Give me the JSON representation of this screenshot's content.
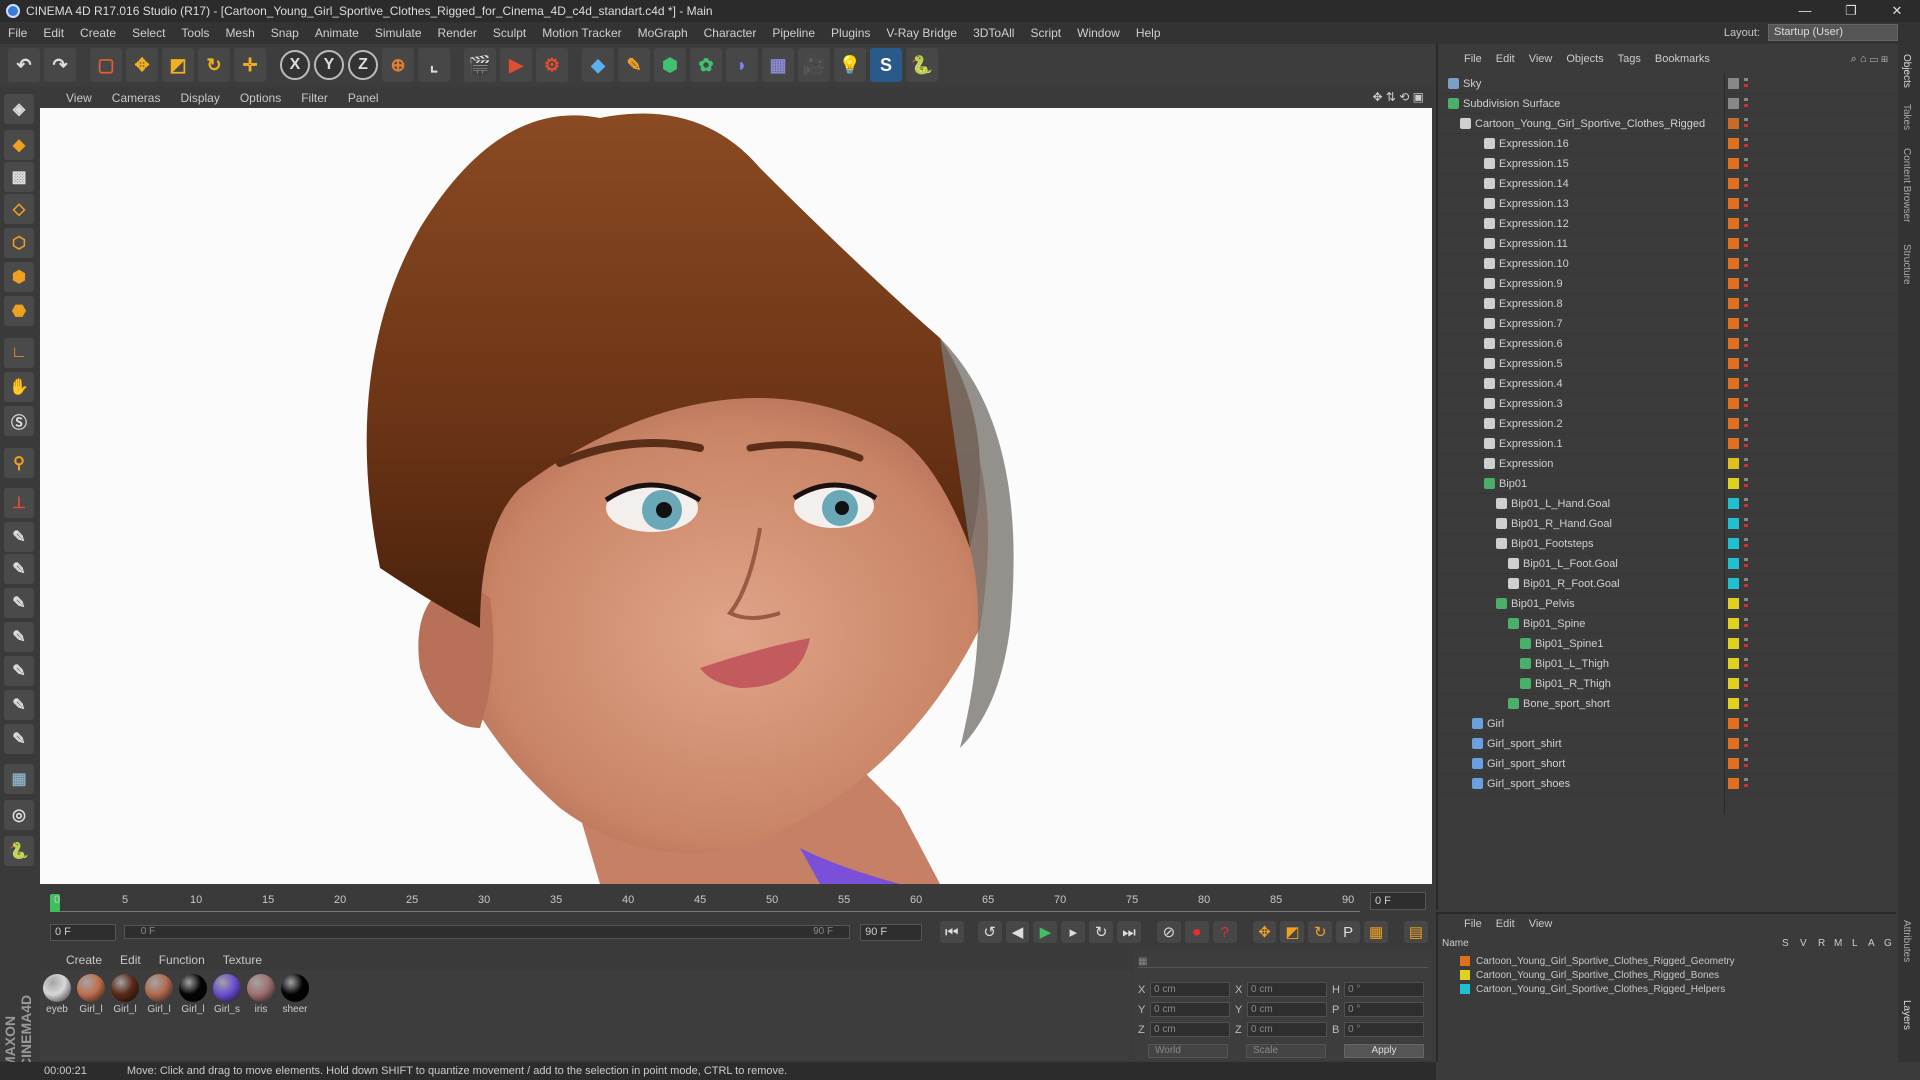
{
  "window": {
    "title": "CINEMA 4D R17.016 Studio (R17) - [Cartoon_Young_Girl_Sportive_Clothes_Rigged_for_Cinema_4D_c4d_standart.c4d *] - Main",
    "min": "—",
    "max": "❐",
    "close": "✕"
  },
  "menubar": {
    "items": [
      "File",
      "Edit",
      "Create",
      "Select",
      "Tools",
      "Mesh",
      "Snap",
      "Animate",
      "Simulate",
      "Render",
      "Sculpt",
      "Motion Tracker",
      "MoGraph",
      "Character",
      "Pipeline",
      "Plugins",
      "V-Ray Bridge",
      "3DToAll",
      "Script",
      "Window",
      "Help"
    ],
    "layout_label": "Layout:",
    "layout_value": "Startup (User)"
  },
  "viewport_menu": [
    "View",
    "Cameras",
    "Display",
    "Options",
    "Filter",
    "Panel"
  ],
  "timeline": {
    "ticks": [
      "0",
      "5",
      "10",
      "15",
      "20",
      "25",
      "30",
      "35",
      "40",
      "45",
      "50",
      "55",
      "60",
      "65",
      "70",
      "75",
      "80",
      "85",
      "90"
    ],
    "current_frame": "0 F"
  },
  "playbar": {
    "start": "0 F",
    "slider_start": "0 F",
    "slider_end": "90 F",
    "end": "90 F"
  },
  "material_menu": [
    "Create",
    "Edit",
    "Function",
    "Texture"
  ],
  "materials": [
    {
      "label": "eyeb",
      "color": "#d8d8d8"
    },
    {
      "label": "Girl_l",
      "color": "#c07050"
    },
    {
      "label": "Girl_l",
      "color": "#5a2a18"
    },
    {
      "label": "Girl_l",
      "color": "#b06a50"
    },
    {
      "label": "Girl_l",
      "color": "#050505"
    },
    {
      "label": "Girl_s",
      "color": "#6b4fd0"
    },
    {
      "label": "iris",
      "color": "#a07070"
    },
    {
      "label": "sheer",
      "color": "#020202"
    }
  ],
  "coords": {
    "rows": [
      [
        {
          "c": "X",
          "v": "0 cm"
        },
        {
          "c": "X",
          "v": "0 cm"
        },
        {
          "c": "H",
          "v": "0 °"
        }
      ],
      [
        {
          "c": "Y",
          "v": "0 cm"
        },
        {
          "c": "Y",
          "v": "0 cm"
        },
        {
          "c": "P",
          "v": "0 °"
        }
      ],
      [
        {
          "c": "Z",
          "v": "0 cm"
        },
        {
          "c": "Z",
          "v": "0 cm"
        },
        {
          "c": "B",
          "v": "0 °"
        }
      ]
    ],
    "world": "World",
    "scale": "Scale",
    "apply": "Apply"
  },
  "status": {
    "time": "00:00:21",
    "message": "Move: Click and drag to move elements. Hold down SHIFT to quantize movement / add to the selection in point mode, CTRL to remove."
  },
  "object_manager": {
    "menu": [
      "File",
      "Edit",
      "View",
      "Objects",
      "Tags",
      "Bookmarks"
    ],
    "objects": [
      {
        "name": "Sky",
        "indent": 0,
        "icon": "#7aa0c8",
        "tag": "#888"
      },
      {
        "name": "Subdivision Surface",
        "indent": 0,
        "icon": "#49b06a",
        "tag": "#888"
      },
      {
        "name": "Cartoon_Young_Girl_Sportive_Clothes_Rigged",
        "indent": 1,
        "icon": "#cfcfcf",
        "tag": "#c86a2a"
      },
      {
        "name": "Expression.16",
        "indent": 3,
        "icon": "#cfcfcf",
        "tag": "#e07020"
      },
      {
        "name": "Expression.15",
        "indent": 3,
        "icon": "#cfcfcf",
        "tag": "#e07020"
      },
      {
        "name": "Expression.14",
        "indent": 3,
        "icon": "#cfcfcf",
        "tag": "#e07020"
      },
      {
        "name": "Expression.13",
        "indent": 3,
        "icon": "#cfcfcf",
        "tag": "#e07020"
      },
      {
        "name": "Expression.12",
        "indent": 3,
        "icon": "#cfcfcf",
        "tag": "#e07020"
      },
      {
        "name": "Expression.11",
        "indent": 3,
        "icon": "#cfcfcf",
        "tag": "#e07020"
      },
      {
        "name": "Expression.10",
        "indent": 3,
        "icon": "#cfcfcf",
        "tag": "#e07020"
      },
      {
        "name": "Expression.9",
        "indent": 3,
        "icon": "#cfcfcf",
        "tag": "#e07020"
      },
      {
        "name": "Expression.8",
        "indent": 3,
        "icon": "#cfcfcf",
        "tag": "#e07020"
      },
      {
        "name": "Expression.7",
        "indent": 3,
        "icon": "#cfcfcf",
        "tag": "#e07020"
      },
      {
        "name": "Expression.6",
        "indent": 3,
        "icon": "#cfcfcf",
        "tag": "#e07020"
      },
      {
        "name": "Expression.5",
        "indent": 3,
        "icon": "#cfcfcf",
        "tag": "#e07020"
      },
      {
        "name": "Expression.4",
        "indent": 3,
        "icon": "#cfcfcf",
        "tag": "#e07020"
      },
      {
        "name": "Expression.3",
        "indent": 3,
        "icon": "#cfcfcf",
        "tag": "#e07020"
      },
      {
        "name": "Expression.2",
        "indent": 3,
        "icon": "#cfcfcf",
        "tag": "#e07020"
      },
      {
        "name": "Expression.1",
        "indent": 3,
        "icon": "#cfcfcf",
        "tag": "#e07020"
      },
      {
        "name": "Expression",
        "indent": 3,
        "icon": "#cfcfcf",
        "tag": "#e0c020"
      },
      {
        "name": "Bip01",
        "indent": 3,
        "icon": "#49b06a",
        "tag": "#e0d020"
      },
      {
        "name": "Bip01_L_Hand.Goal",
        "indent": 4,
        "icon": "#cfcfcf",
        "tag": "#20c0d0"
      },
      {
        "name": "Bip01_R_Hand.Goal",
        "indent": 4,
        "icon": "#cfcfcf",
        "tag": "#20c0d0"
      },
      {
        "name": "Bip01_Footsteps",
        "indent": 4,
        "icon": "#cfcfcf",
        "tag": "#20c0d0"
      },
      {
        "name": "Bip01_L_Foot.Goal",
        "indent": 5,
        "icon": "#cfcfcf",
        "tag": "#20c0d0"
      },
      {
        "name": "Bip01_R_Foot.Goal",
        "indent": 5,
        "icon": "#cfcfcf",
        "tag": "#20c0d0"
      },
      {
        "name": "Bip01_Pelvis",
        "indent": 4,
        "icon": "#49b06a",
        "tag": "#e0d020"
      },
      {
        "name": "Bip01_Spine",
        "indent": 5,
        "icon": "#49b06a",
        "tag": "#e0d020"
      },
      {
        "name": "Bip01_Spine1",
        "indent": 6,
        "icon": "#49b06a",
        "tag": "#e0d020"
      },
      {
        "name": "Bip01_L_Thigh",
        "indent": 6,
        "icon": "#49b06a",
        "tag": "#e0d020"
      },
      {
        "name": "Bip01_R_Thigh",
        "indent": 6,
        "icon": "#49b06a",
        "tag": "#e0d020"
      },
      {
        "name": "Bone_sport_short",
        "indent": 5,
        "icon": "#49b06a",
        "tag": "#e0d020"
      },
      {
        "name": "Girl",
        "indent": 2,
        "icon": "#6aa0e0",
        "tag": "#e07020"
      },
      {
        "name": "Girl_sport_shirt",
        "indent": 2,
        "icon": "#6aa0e0",
        "tag": "#e07020"
      },
      {
        "name": "Girl_sport_short",
        "indent": 2,
        "icon": "#6aa0e0",
        "tag": "#e07020"
      },
      {
        "name": "Girl_sport_shoes",
        "indent": 2,
        "icon": "#6aa0e0",
        "tag": "#e07020"
      }
    ]
  },
  "side_tabs": [
    "Objects",
    "Takes",
    "Content Browser",
    "Structure",
    "Attributes",
    "Layers"
  ],
  "layer_manager": {
    "menu": [
      "File",
      "Edit",
      "View"
    ],
    "columns": [
      "Name",
      "S",
      "V",
      "R",
      "M",
      "L",
      "A",
      "G"
    ],
    "layers": [
      {
        "name": "Cartoon_Young_Girl_Sportive_Clothes_Rigged_Geometry",
        "color": "#e07020"
      },
      {
        "name": "Cartoon_Young_Girl_Sportive_Clothes_Rigged_Bones",
        "color": "#e0d020"
      },
      {
        "name": "Cartoon_Young_Girl_Sportive_Clothes_Rigged_Helpers",
        "color": "#20c0d0"
      }
    ]
  },
  "axes": {
    "x": "X",
    "y": "Y",
    "z": "Z"
  }
}
